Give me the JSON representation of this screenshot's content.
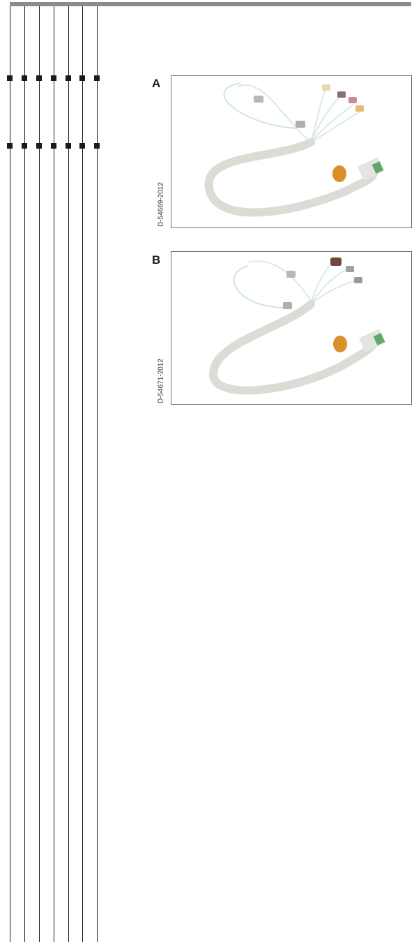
{
  "figures": [
    {
      "letter": "A",
      "code": "D-54669-2012"
    },
    {
      "letter": "B",
      "code": "D-54671-2012"
    }
  ]
}
